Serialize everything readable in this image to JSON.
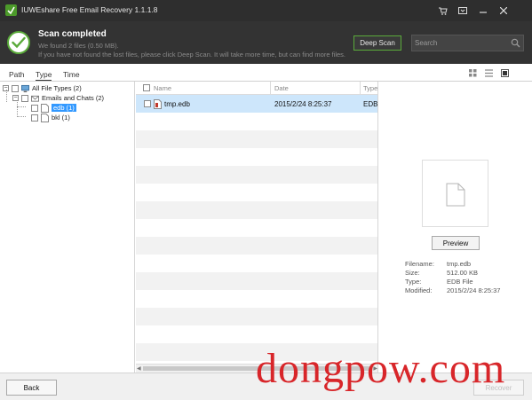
{
  "window": {
    "title": "IUWEshare Free Email Recovery 1.1.1.8",
    "buttons": [
      "cart-icon",
      "register-icon",
      "minimize-icon",
      "close-icon"
    ]
  },
  "status": {
    "title": "Scan completed",
    "line1": "We found 2 files (0.50 MB).",
    "line2": "If you have not found the lost files, please click Deep Scan. It will take more time, but can find more files.",
    "deep_scan_label": "Deep Scan",
    "search_placeholder": "Search",
    "accent": "#5aaa3a"
  },
  "tabs": [
    {
      "label": "Path",
      "active": false
    },
    {
      "label": "Type",
      "active": true
    },
    {
      "label": "Time",
      "active": false
    }
  ],
  "tree": {
    "root": {
      "label": "All File Types (2)"
    },
    "child": {
      "label": "Emails and Chats (2)"
    },
    "leaves": [
      {
        "label": "edb (1)",
        "selected": true
      },
      {
        "label": "bkl (1)",
        "selected": false
      }
    ]
  },
  "list": {
    "columns": [
      "Name",
      "Date",
      "Type"
    ],
    "rows": [
      {
        "name": "tmp.edb",
        "date": "2015/2/24 8:25:37",
        "type": "EDB"
      }
    ]
  },
  "preview": {
    "button_label": "Preview",
    "fields": [
      {
        "key": "Filename:",
        "value": "tmp.edb"
      },
      {
        "key": "Size:",
        "value": "512.00 KB"
      },
      {
        "key": "Type:",
        "value": "EDB File"
      },
      {
        "key": "Modified:",
        "value": "2015/2/24 8:25:37"
      }
    ]
  },
  "footer": {
    "back_label": "Back",
    "recover_label": "Recover"
  },
  "watermark": "dongpow.com"
}
